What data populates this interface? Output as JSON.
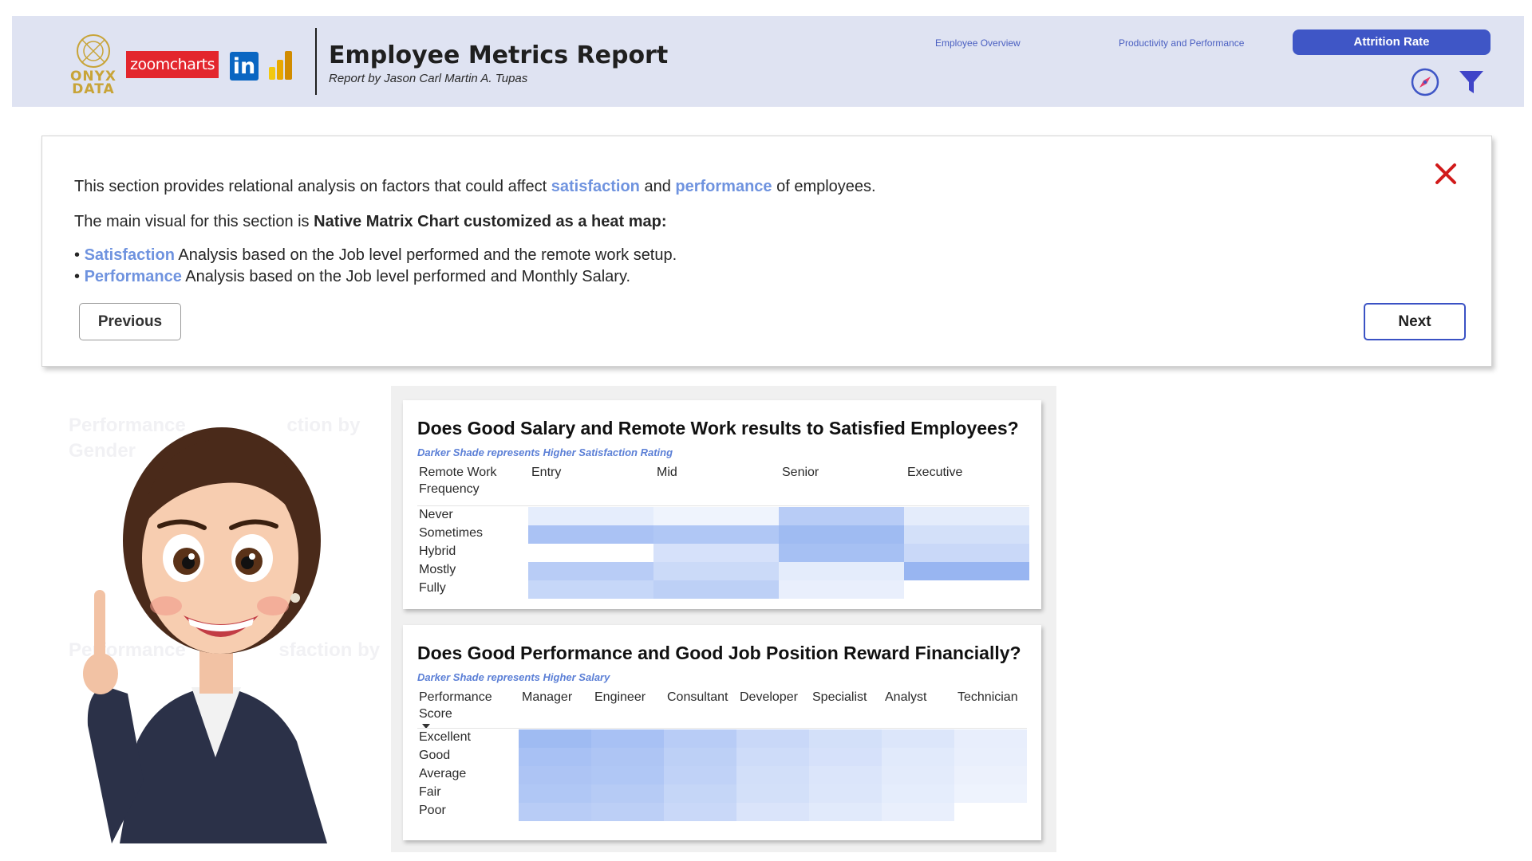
{
  "header": {
    "onyx_logo_text": "ONYX DATA",
    "zoomcharts_logo_text": "zoomcharts",
    "linkedin_logo_text": "in",
    "title": "Employee Metrics Report",
    "subtitle": "Report by Jason Carl Martin A. Tupas",
    "nav": {
      "overview": "Employee Overview",
      "productivity": "Productivity and Performance",
      "attrition": "Attrition Rate"
    },
    "icons": {
      "compass": "compass-icon",
      "filter": "filter-icon"
    },
    "colors": {
      "background": "#dfe3f2",
      "accent": "#3f56c6",
      "logo_gold": "#c8a438"
    }
  },
  "dialog": {
    "line1": {
      "pre": "This section provides relational analysis on factors that could affect ",
      "hl1": "satisfaction",
      "mid": " and ",
      "hl2": "performance",
      "post": " of employees."
    },
    "line2": {
      "pre": "The main visual for this section is ",
      "bold": "Native Matrix Chart customized as a heat map:"
    },
    "bullet1": {
      "bullet": "• ",
      "hl": "Satisfaction",
      "text": " Analysis based on the Job level performed and the remote work setup."
    },
    "bullet2": {
      "bullet": "• ",
      "hl": "Performance",
      "text": " Analysis based on the Job level performed and Monthly Salary."
    },
    "previous_label": "Previous",
    "next_label": "Next",
    "close_icon": "close-icon",
    "highlight_color": "#6f93df"
  },
  "chart_data": [
    {
      "type": "heatmap",
      "title": "Does Good Salary and Remote Work results to Satisfied Employees?",
      "subtitle": "Darker Shade represents Higher Satisfaction Rating",
      "row_header": "Remote Work Frequency",
      "columns": [
        "Entry",
        "Mid",
        "Senior",
        "Executive"
      ],
      "rows": [
        "Never",
        "Sometimes",
        "Hybrid",
        "Mostly",
        "Fully"
      ],
      "intensity": [
        [
          0.14,
          0.05,
          0.55,
          0.15
        ],
        [
          0.68,
          0.62,
          0.78,
          0.3
        ],
        [
          0.0,
          0.28,
          0.72,
          0.4
        ],
        [
          0.55,
          0.38,
          0.15,
          0.85
        ],
        [
          0.42,
          0.5,
          0.1,
          0.0
        ]
      ],
      "color": "#7ea3ee"
    },
    {
      "type": "heatmap",
      "title": "Does Good Performance and Good Job Position Reward Financially?",
      "subtitle": "Darker Shade represents Higher Salary",
      "row_header": "Performance Score",
      "columns": [
        "Manager",
        "Engineer",
        "Consultant",
        "Developer",
        "Specialist",
        "Analyst",
        "Technician"
      ],
      "rows": [
        "Excellent",
        "Good",
        "Average",
        "Fair",
        "Poor"
      ],
      "intensity": [
        [
          0.78,
          0.7,
          0.55,
          0.4,
          0.3,
          0.22,
          0.12
        ],
        [
          0.7,
          0.65,
          0.5,
          0.35,
          0.28,
          0.18,
          0.1
        ],
        [
          0.66,
          0.62,
          0.48,
          0.32,
          0.24,
          0.16,
          0.08
        ],
        [
          0.62,
          0.58,
          0.44,
          0.3,
          0.22,
          0.14,
          0.06
        ],
        [
          0.55,
          0.52,
          0.4,
          0.25,
          0.18,
          0.1,
          0.0
        ]
      ],
      "color": "#7ea3ee"
    }
  ],
  "background_faded": {
    "text1a": "Performance",
    "text1b": "ction by",
    "text1c": "Gender",
    "text2a": "Performance",
    "text2b": "sfaction by"
  }
}
